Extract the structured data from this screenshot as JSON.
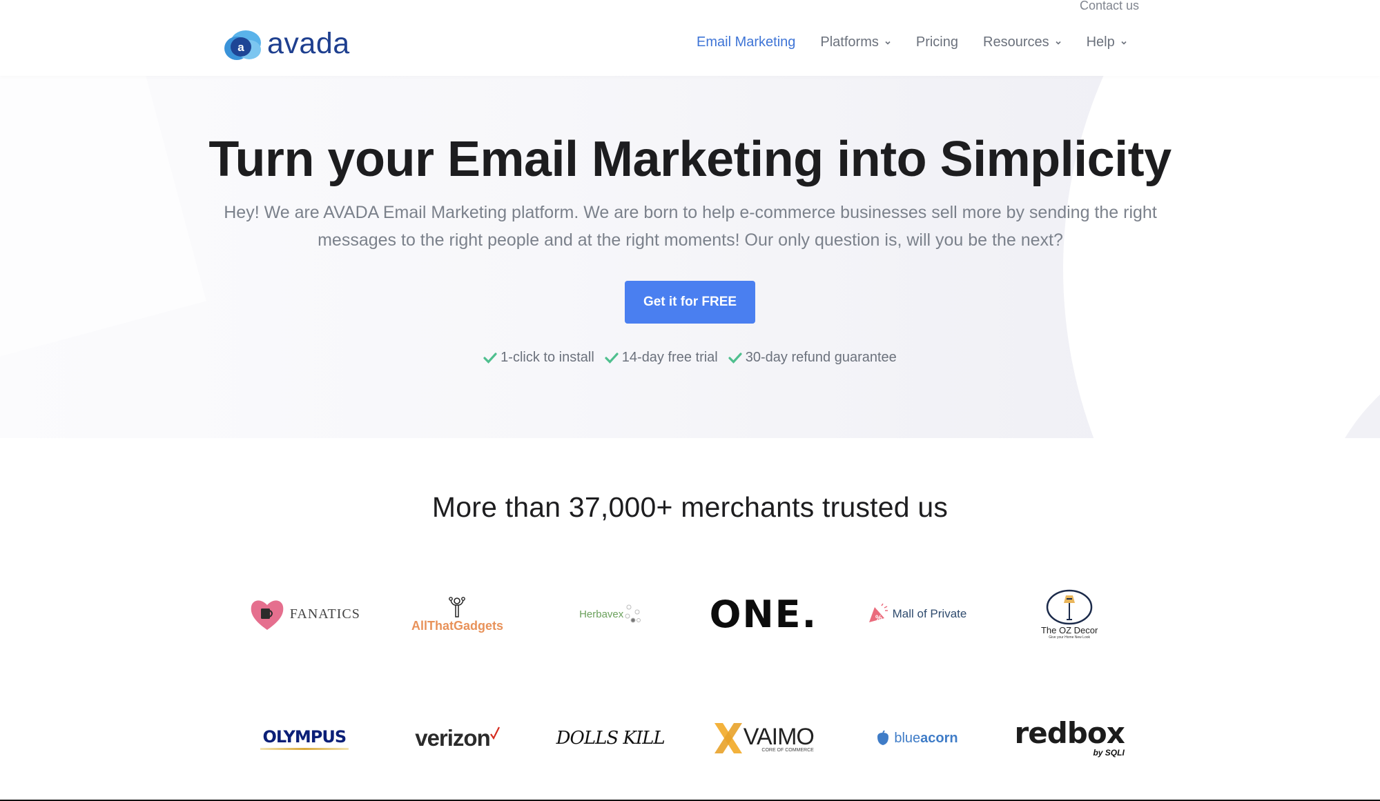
{
  "header": {
    "contact_label": "Contact us",
    "logo_text": "avada",
    "logo_letter": "a",
    "nav": [
      {
        "label": "Email Marketing",
        "active": true,
        "dropdown": false
      },
      {
        "label": "Platforms",
        "active": false,
        "dropdown": true
      },
      {
        "label": "Pricing",
        "active": false,
        "dropdown": false
      },
      {
        "label": "Resources",
        "active": false,
        "dropdown": true
      },
      {
        "label": "Help",
        "active": false,
        "dropdown": true
      }
    ]
  },
  "hero": {
    "title": "Turn your Email Marketing into Simplicity",
    "subtitle": "Hey! We are AVADA Email Marketing platform. We are born to help e-commerce businesses sell more by sending the right messages to the right people and at the right moments! Our only question is, will you be the next?",
    "cta_label": "Get it for FREE",
    "features": [
      {
        "icon": "check-icon",
        "label": "1-click to install"
      },
      {
        "icon": "check-icon",
        "label": "14-day free trial"
      },
      {
        "icon": "check-icon",
        "label": "30-day refund guarantee"
      }
    ]
  },
  "merchants": {
    "title": "More than 37,000+ merchants trusted us",
    "row1": [
      {
        "name": "FANATICS"
      },
      {
        "name": "AllThatGadgets"
      },
      {
        "name": "Herbavex"
      },
      {
        "name": "ONE."
      },
      {
        "name": "Mall of Private"
      },
      {
        "name": "The OZ Decor",
        "tagline": "Give your Home New Look"
      }
    ],
    "row2": [
      {
        "name": "OLYMPUS"
      },
      {
        "name": "verizon"
      },
      {
        "name": "DOLLS KILL"
      },
      {
        "name": "VAIMO",
        "tagline": "CORE OF COMMERCE"
      },
      {
        "name": "blue acorn",
        "parts": [
          "blue",
          "acorn"
        ]
      },
      {
        "name": "redbox",
        "tagline": "by SQLI"
      }
    ]
  },
  "colors": {
    "brand_blue": "#1e3f8f",
    "nav_active": "#3e74d6",
    "cta": "#4a7ff0",
    "check": "#4fbf8e"
  }
}
